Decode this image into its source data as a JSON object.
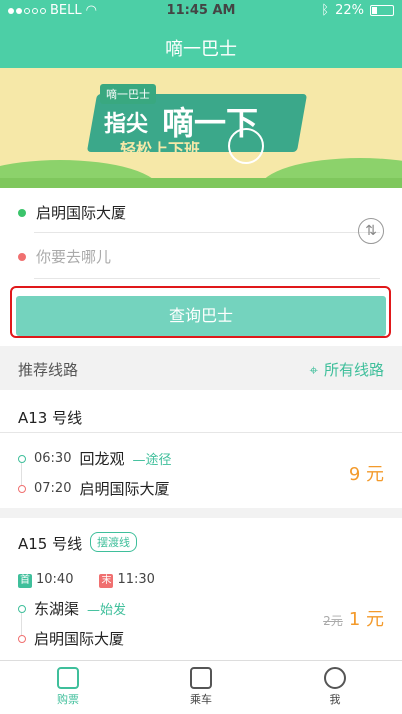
{
  "status": {
    "carrier": "BELL",
    "time": "11:45 AM",
    "battery": "22%"
  },
  "header": {
    "title": "嘀一巴士"
  },
  "banner": {
    "brand": "嘀一巴士",
    "line1": "指尖",
    "line2": "嘀一下",
    "line3": "轻松上下班"
  },
  "search": {
    "from": "启明国际大厦",
    "to_placeholder": "你要去哪儿",
    "button": "查询巴士"
  },
  "recommended": {
    "title": "推荐线路",
    "all_routes": "所有线路"
  },
  "routes": [
    {
      "name": "A13 号线",
      "stops": [
        {
          "time": "06:30",
          "name": "回龙观",
          "note": "途径"
        },
        {
          "time": "07:20",
          "name": "启明国际大厦"
        }
      ],
      "price": "9 元"
    },
    {
      "name": "A15 号线",
      "tag": "摆渡线",
      "first": {
        "label": "首",
        "time": "10:40"
      },
      "last": {
        "label": "末",
        "time": "11:30"
      },
      "stops": [
        {
          "name": "东湖渠",
          "note": "始发"
        },
        {
          "name": "启明国际大厦"
        }
      ],
      "old_price": "2元",
      "price": "1 元"
    }
  ],
  "tabs": [
    {
      "label": "购票",
      "icon": "ticket-icon",
      "active": true
    },
    {
      "label": "乘车",
      "icon": "bus-icon",
      "active": false
    },
    {
      "label": "我",
      "icon": "user-icon",
      "active": false
    }
  ],
  "colors": {
    "accent": "#4ccfa6",
    "price": "#f39a2b",
    "button": "#74d3be",
    "highlight": "#e0181a"
  }
}
